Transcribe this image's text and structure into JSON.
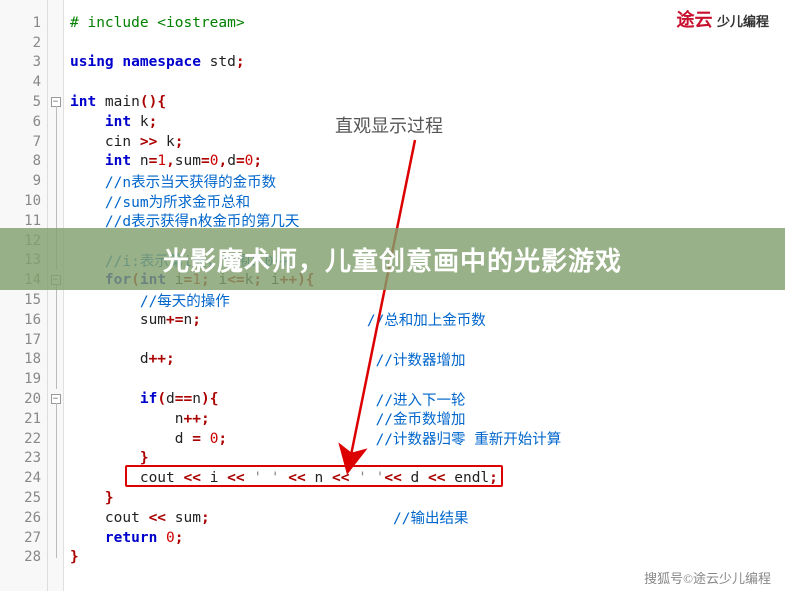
{
  "logo": {
    "brand": "途云",
    "sub": "少儿编程"
  },
  "annotation": "直观显示过程",
  "overlay_title": "光影魔术师，儿童创意画中的光影游戏",
  "watermark": "搜狐号©途云少儿编程",
  "lines": [
    {
      "n": 1,
      "fold": null,
      "tokens": [
        [
          "pp",
          "# include <iostream>"
        ]
      ]
    },
    {
      "n": 2,
      "fold": null,
      "tokens": []
    },
    {
      "n": 3,
      "fold": null,
      "tokens": [
        [
          "kw",
          "using namespace"
        ],
        [
          "id",
          " std"
        ],
        [
          "op",
          ";"
        ]
      ]
    },
    {
      "n": 4,
      "fold": null,
      "tokens": []
    },
    {
      "n": 5,
      "fold": "box",
      "tokens": [
        [
          "kw",
          "int"
        ],
        [
          "id",
          " main"
        ],
        [
          "op",
          "(){"
        ]
      ]
    },
    {
      "n": 6,
      "fold": "line",
      "tokens": [
        [
          "id",
          "    "
        ],
        [
          "kw",
          "int"
        ],
        [
          "id",
          " k"
        ],
        [
          "op",
          ";"
        ]
      ]
    },
    {
      "n": 7,
      "fold": "line",
      "tokens": [
        [
          "id",
          "    cin "
        ],
        [
          "op",
          ">>"
        ],
        [
          "id",
          " k"
        ],
        [
          "op",
          ";"
        ]
      ]
    },
    {
      "n": 8,
      "fold": "line",
      "tokens": [
        [
          "id",
          "    "
        ],
        [
          "kw",
          "int"
        ],
        [
          "id",
          " n"
        ],
        [
          "op",
          "="
        ],
        [
          "num",
          "1"
        ],
        [
          "op",
          ","
        ],
        [
          "id",
          "sum"
        ],
        [
          "op",
          "="
        ],
        [
          "num",
          "0"
        ],
        [
          "op",
          ","
        ],
        [
          "id",
          "d"
        ],
        [
          "op",
          "="
        ],
        [
          "num",
          "0"
        ],
        [
          "op",
          ";"
        ]
      ]
    },
    {
      "n": 9,
      "fold": "line",
      "tokens": [
        [
          "id",
          "    "
        ],
        [
          "cm",
          "//n表示当天获得的金币数"
        ]
      ]
    },
    {
      "n": 10,
      "fold": "line",
      "tokens": [
        [
          "id",
          "    "
        ],
        [
          "cm",
          "//sum为所求金币总和"
        ]
      ]
    },
    {
      "n": 11,
      "fold": "line",
      "tokens": [
        [
          "id",
          "    "
        ],
        [
          "cm",
          "//d表示获得n枚金币的第几天"
        ]
      ]
    },
    {
      "n": 12,
      "fold": "line",
      "tokens": []
    },
    {
      "n": 13,
      "fold": "line",
      "tokens": [
        [
          "id",
          "    "
        ],
        [
          "cm",
          "//i:表示第i天，范围：0~k"
        ]
      ]
    },
    {
      "n": 14,
      "fold": "box",
      "tokens": [
        [
          "id",
          "    "
        ],
        [
          "kw",
          "for"
        ],
        [
          "op",
          "("
        ],
        [
          "kw",
          "int"
        ],
        [
          "id",
          " i"
        ],
        [
          "op",
          "="
        ],
        [
          "num",
          "1"
        ],
        [
          "op",
          ";"
        ],
        [
          "id",
          " i"
        ],
        [
          "op",
          "<="
        ],
        [
          "id",
          "k"
        ],
        [
          "op",
          ";"
        ],
        [
          "id",
          " i"
        ],
        [
          "op",
          "++){"
        ]
      ]
    },
    {
      "n": 15,
      "fold": "line",
      "tokens": [
        [
          "id",
          "        "
        ],
        [
          "cm",
          "//每天的操作"
        ]
      ]
    },
    {
      "n": 16,
      "fold": "line",
      "tokens": [
        [
          "id",
          "        sum"
        ],
        [
          "op",
          "+="
        ],
        [
          "id",
          "n"
        ],
        [
          "op",
          ";"
        ],
        [
          "id",
          "                   "
        ],
        [
          "cm",
          "//总和加上金币数"
        ]
      ]
    },
    {
      "n": 17,
      "fold": "line",
      "tokens": []
    },
    {
      "n": 18,
      "fold": "line",
      "tokens": [
        [
          "id",
          "        d"
        ],
        [
          "op",
          "++;"
        ],
        [
          "id",
          "                       "
        ],
        [
          "cm",
          "//计数器增加"
        ]
      ]
    },
    {
      "n": 19,
      "fold": "line",
      "tokens": []
    },
    {
      "n": 20,
      "fold": "box",
      "tokens": [
        [
          "id",
          "        "
        ],
        [
          "kw",
          "if"
        ],
        [
          "op",
          "("
        ],
        [
          "id",
          "d"
        ],
        [
          "op",
          "=="
        ],
        [
          "id",
          "n"
        ],
        [
          "op",
          "){"
        ],
        [
          "id",
          "                  "
        ],
        [
          "cm",
          "//进入下一轮"
        ]
      ]
    },
    {
      "n": 21,
      "fold": "line",
      "tokens": [
        [
          "id",
          "            n"
        ],
        [
          "op",
          "++;"
        ],
        [
          "id",
          "                   "
        ],
        [
          "cm",
          "//金币数增加"
        ]
      ]
    },
    {
      "n": 22,
      "fold": "line",
      "tokens": [
        [
          "id",
          "            d "
        ],
        [
          "op",
          "="
        ],
        [
          "id",
          " "
        ],
        [
          "num",
          "0"
        ],
        [
          "op",
          ";"
        ],
        [
          "id",
          "                 "
        ],
        [
          "cm",
          "//计数器归零 重新开始计算"
        ]
      ]
    },
    {
      "n": 23,
      "fold": "line",
      "tokens": [
        [
          "id",
          "        "
        ],
        [
          "op",
          "}"
        ]
      ]
    },
    {
      "n": 24,
      "fold": "line",
      "tokens": [
        [
          "id",
          "        cout "
        ],
        [
          "op",
          "<<"
        ],
        [
          "id",
          " i "
        ],
        [
          "op",
          "<<"
        ],
        [
          "str",
          " ' '"
        ],
        [
          "id",
          " "
        ],
        [
          "op",
          "<<"
        ],
        [
          "id",
          " n "
        ],
        [
          "op",
          "<<"
        ],
        [
          "str",
          " ' '"
        ],
        [
          "op",
          "<<"
        ],
        [
          "id",
          " d "
        ],
        [
          "op",
          "<<"
        ],
        [
          "id",
          " endl"
        ],
        [
          "op",
          ";"
        ]
      ]
    },
    {
      "n": 25,
      "fold": "line",
      "tokens": [
        [
          "id",
          "    "
        ],
        [
          "op",
          "}"
        ]
      ]
    },
    {
      "n": 26,
      "fold": "line",
      "tokens": [
        [
          "id",
          "    cout "
        ],
        [
          "op",
          "<<"
        ],
        [
          "id",
          " sum"
        ],
        [
          "op",
          ";"
        ],
        [
          "id",
          "                     "
        ],
        [
          "cm",
          "//输出结果"
        ]
      ]
    },
    {
      "n": 27,
      "fold": "line",
      "tokens": [
        [
          "id",
          "    "
        ],
        [
          "kw",
          "return"
        ],
        [
          "id",
          " "
        ],
        [
          "num",
          "0"
        ],
        [
          "op",
          ";"
        ]
      ]
    },
    {
      "n": 28,
      "fold": "end",
      "tokens": [
        [
          "op",
          "}"
        ]
      ]
    }
  ]
}
